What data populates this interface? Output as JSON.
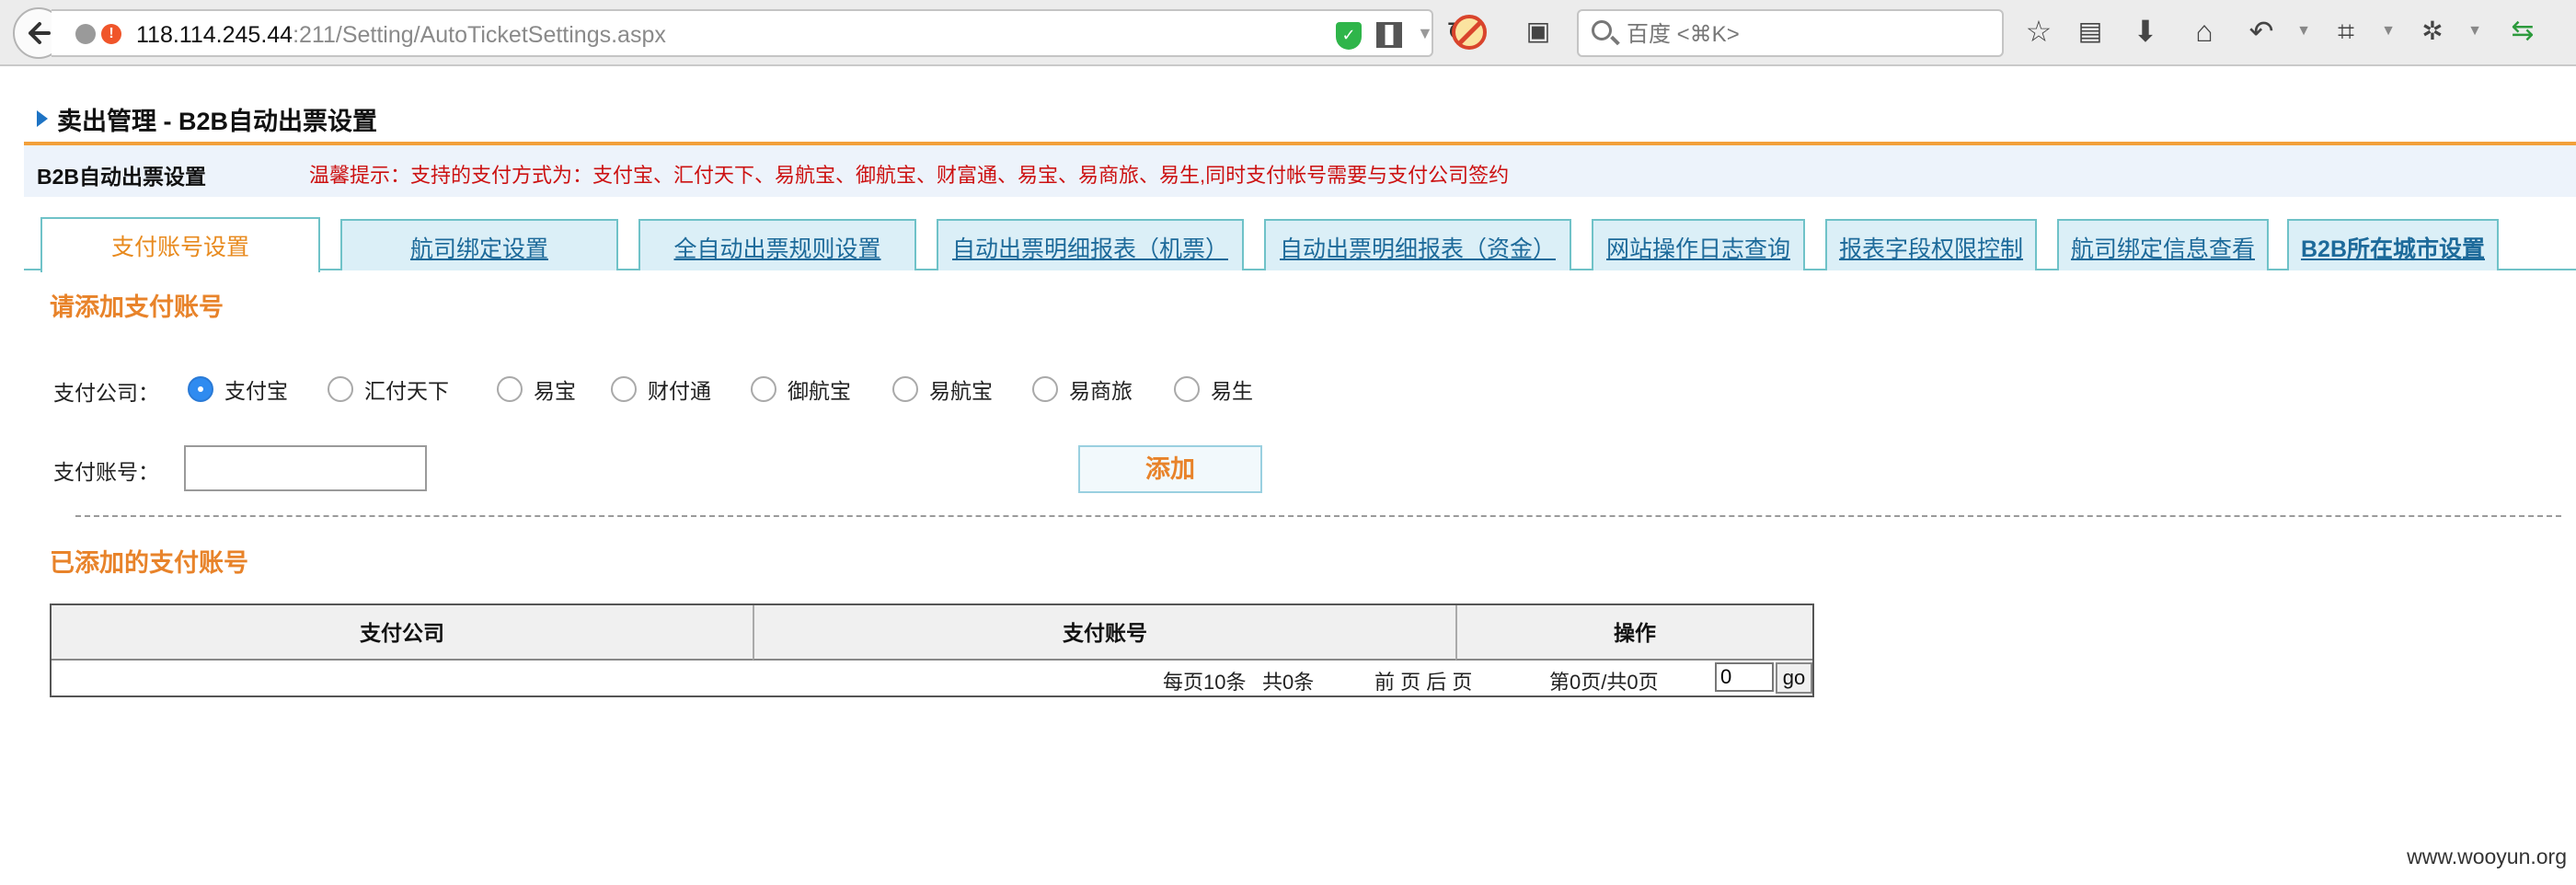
{
  "browser": {
    "url_host": "118.114.245.44",
    "url_path": ":211/Setting/AutoTicketSettings.aspx",
    "search_placeholder": "百度 <⌘K>"
  },
  "page": {
    "title": "卖出管理 - B2B自动出票设置",
    "notice_label": "B2B自动出票设置",
    "notice_text": "温馨提示：支持的支付方式为：支付宝、汇付天下、易航宝、御航宝、财富通、易宝、易商旅、易生,同时支付帐号需要与支付公司签约"
  },
  "tabs": [
    {
      "label": "支付账号设置",
      "active": true
    },
    {
      "label": "航司绑定设置",
      "active": false
    },
    {
      "label": "全自动出票规则设置",
      "active": false
    },
    {
      "label": "自动出票明细报表（机票）",
      "active": false
    },
    {
      "label": "自动出票明细报表（资金）",
      "active": false
    },
    {
      "label": "网站操作日志查询",
      "active": false
    },
    {
      "label": "报表字段权限控制",
      "active": false
    },
    {
      "label": "航司绑定信息查看",
      "active": false
    },
    {
      "label": "B2B所在城市设置",
      "active": false
    }
  ],
  "form": {
    "section_title": "请添加支付账号",
    "company_label": "支付公司：",
    "account_label": "支付账号：",
    "account_value": "",
    "add_button": "添加",
    "companies": [
      {
        "label": "支付宝",
        "checked": true
      },
      {
        "label": "汇付天下",
        "checked": false
      },
      {
        "label": "易宝",
        "checked": false
      },
      {
        "label": "财付通",
        "checked": false
      },
      {
        "label": "御航宝",
        "checked": false
      },
      {
        "label": "易航宝",
        "checked": false
      },
      {
        "label": "易商旅",
        "checked": false
      },
      {
        "label": "易生",
        "checked": false
      }
    ]
  },
  "list": {
    "section_title": "已添加的支付账号",
    "columns": [
      "支付公司",
      "支付账号",
      "操作"
    ],
    "pager": {
      "per_page": "每页10条",
      "total": "共0条",
      "nav": "前 页 后 页",
      "page_info": "第0页/共0页",
      "page_input": "0",
      "go_label": "go"
    }
  },
  "watermark": "www.wooyun.org"
}
